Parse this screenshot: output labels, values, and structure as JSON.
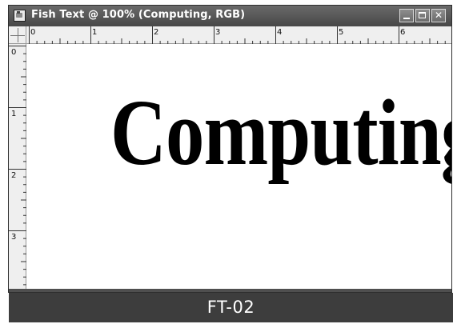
{
  "window": {
    "title": "Fish Text @ 100% (Computing, RGB)",
    "app_icon": "image-document-icon",
    "controls": {
      "minimize_icon": "minimize-icon",
      "maximize_icon": "maximize-icon",
      "close_icon": "close-icon",
      "close_glyph": "✕"
    }
  },
  "rulers": {
    "unit": "inches",
    "horizontal_labels": [
      "0",
      "1",
      "2",
      "3",
      "4",
      "5",
      "6"
    ],
    "vertical_labels": [
      "0",
      "1",
      "2",
      "3"
    ]
  },
  "canvas": {
    "text": "Computing",
    "background": "#ffffff",
    "text_color": "#000000"
  },
  "caption": {
    "label": "FT-02"
  },
  "colors": {
    "titlebar": "#555555",
    "caption_bar": "#3d3d3d",
    "ruler": "#efefef"
  }
}
